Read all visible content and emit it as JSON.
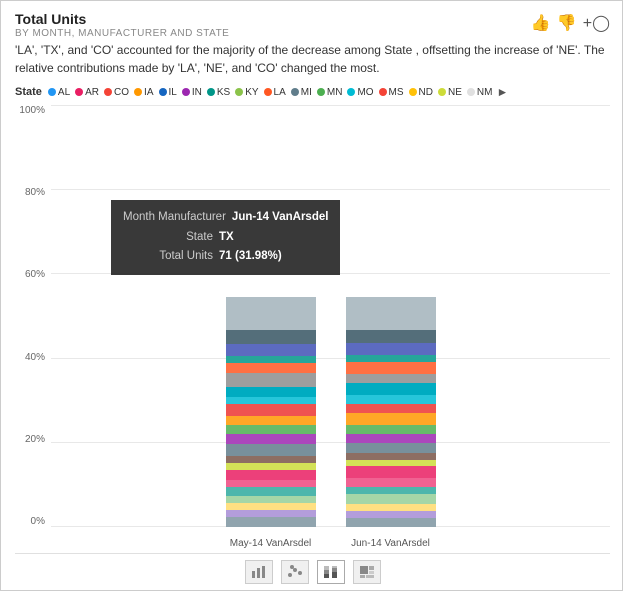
{
  "header": {
    "title": "Total Units",
    "subtitle": "BY MONTH, MANUFACTURER AND STATE",
    "icons": [
      "thumbs-up",
      "thumbs-down",
      "plus"
    ]
  },
  "insight": "'LA', 'TX', and 'CO' accounted for the majority of the decrease among State , offsetting the increase of 'NE'. The relative contributions made by 'LA', 'NE', and 'CO' changed the most.",
  "legend": {
    "label": "State",
    "items": [
      {
        "key": "AL",
        "color": "#2196F3"
      },
      {
        "key": "AR",
        "color": "#E91E63"
      },
      {
        "key": "CO",
        "color": "#f44336"
      },
      {
        "key": "IA",
        "color": "#FF9800"
      },
      {
        "key": "IL",
        "color": "#1565C0"
      },
      {
        "key": "IN",
        "color": "#9C27B0"
      },
      {
        "key": "KS",
        "color": "#009688"
      },
      {
        "key": "KY",
        "color": "#8BC34A"
      },
      {
        "key": "LA",
        "color": "#FF5722"
      },
      {
        "key": "MI",
        "color": "#607D8B"
      },
      {
        "key": "MN",
        "color": "#4CAF50"
      },
      {
        "key": "MO",
        "color": "#00BCD4"
      },
      {
        "key": "MS",
        "color": "#F44336"
      },
      {
        "key": "ND",
        "color": "#FFC107"
      },
      {
        "key": "NE",
        "color": "#CDDC39"
      },
      {
        "key": "NM",
        "color": "#E0E0E0"
      }
    ]
  },
  "yAxis": {
    "labels": [
      "100%",
      "80%",
      "60%",
      "40%",
      "20%",
      "0%"
    ]
  },
  "bars": [
    {
      "label": "May-14 VanArsdel",
      "segments": [
        {
          "color": "#b0bec5",
          "height": 14
        },
        {
          "color": "#546e7a",
          "height": 6
        },
        {
          "color": "#5c6bc0",
          "height": 5
        },
        {
          "color": "#26a69a",
          "height": 3
        },
        {
          "color": "#ff7043",
          "height": 4
        },
        {
          "color": "#9e9e9e",
          "height": 6
        },
        {
          "color": "#00acc1",
          "height": 4
        },
        {
          "color": "#26c6da",
          "height": 3
        },
        {
          "color": "#ef5350",
          "height": 5
        },
        {
          "color": "#ffa726",
          "height": 4
        },
        {
          "color": "#66bb6a",
          "height": 4
        },
        {
          "color": "#ab47bc",
          "height": 4
        },
        {
          "color": "#78909c",
          "height": 5
        },
        {
          "color": "#8d6e63",
          "height": 3
        },
        {
          "color": "#d4e157",
          "height": 3
        },
        {
          "color": "#ec407a",
          "height": 4
        },
        {
          "color": "#f06292",
          "height": 3
        },
        {
          "color": "#4db6ac",
          "height": 4
        },
        {
          "color": "#a5d6a7",
          "height": 3
        },
        {
          "color": "#ffe082",
          "height": 3
        },
        {
          "color": "#b39ddb",
          "height": 3
        },
        {
          "color": "#90a4ae",
          "height": 4
        }
      ]
    },
    {
      "label": "Jun-14 VanArsdel",
      "segments": [
        {
          "color": "#b0bec5",
          "height": 14
        },
        {
          "color": "#546e7a",
          "height": 6
        },
        {
          "color": "#5c6bc0",
          "height": 5
        },
        {
          "color": "#26a69a",
          "height": 3
        },
        {
          "color": "#ff7043",
          "height": 5
        },
        {
          "color": "#9e9e9e",
          "height": 4
        },
        {
          "color": "#00acc1",
          "height": 5
        },
        {
          "color": "#26c6da",
          "height": 4
        },
        {
          "color": "#ef5350",
          "height": 4
        },
        {
          "color": "#ffa726",
          "height": 5
        },
        {
          "color": "#66bb6a",
          "height": 4
        },
        {
          "color": "#ab47bc",
          "height": 4
        },
        {
          "color": "#78909c",
          "height": 4
        },
        {
          "color": "#8d6e63",
          "height": 3
        },
        {
          "color": "#d4e157",
          "height": 3
        },
        {
          "color": "#ec407a",
          "height": 5
        },
        {
          "color": "#f06292",
          "height": 4
        },
        {
          "color": "#4db6ac",
          "height": 3
        },
        {
          "color": "#a5d6a7",
          "height": 4
        },
        {
          "color": "#ffe082",
          "height": 3
        },
        {
          "color": "#b39ddb",
          "height": 3
        },
        {
          "color": "#90a4ae",
          "height": 4
        }
      ]
    }
  ],
  "tooltip": {
    "label1": "Month Manufacturer",
    "value1": "Jun-14 VanArsdel",
    "label2": "State",
    "value2": "TX",
    "label3": "Total Units",
    "value3": "71 (31.98%)"
  },
  "toolbar": {
    "buttons": [
      {
        "icon": "bar-chart",
        "label": "Bar chart",
        "active": false
      },
      {
        "icon": "scatter",
        "label": "Scatter",
        "active": false
      },
      {
        "icon": "stacked-bar",
        "label": "Stacked bar",
        "active": true
      },
      {
        "icon": "treemap",
        "label": "Treemap",
        "active": false
      }
    ]
  }
}
